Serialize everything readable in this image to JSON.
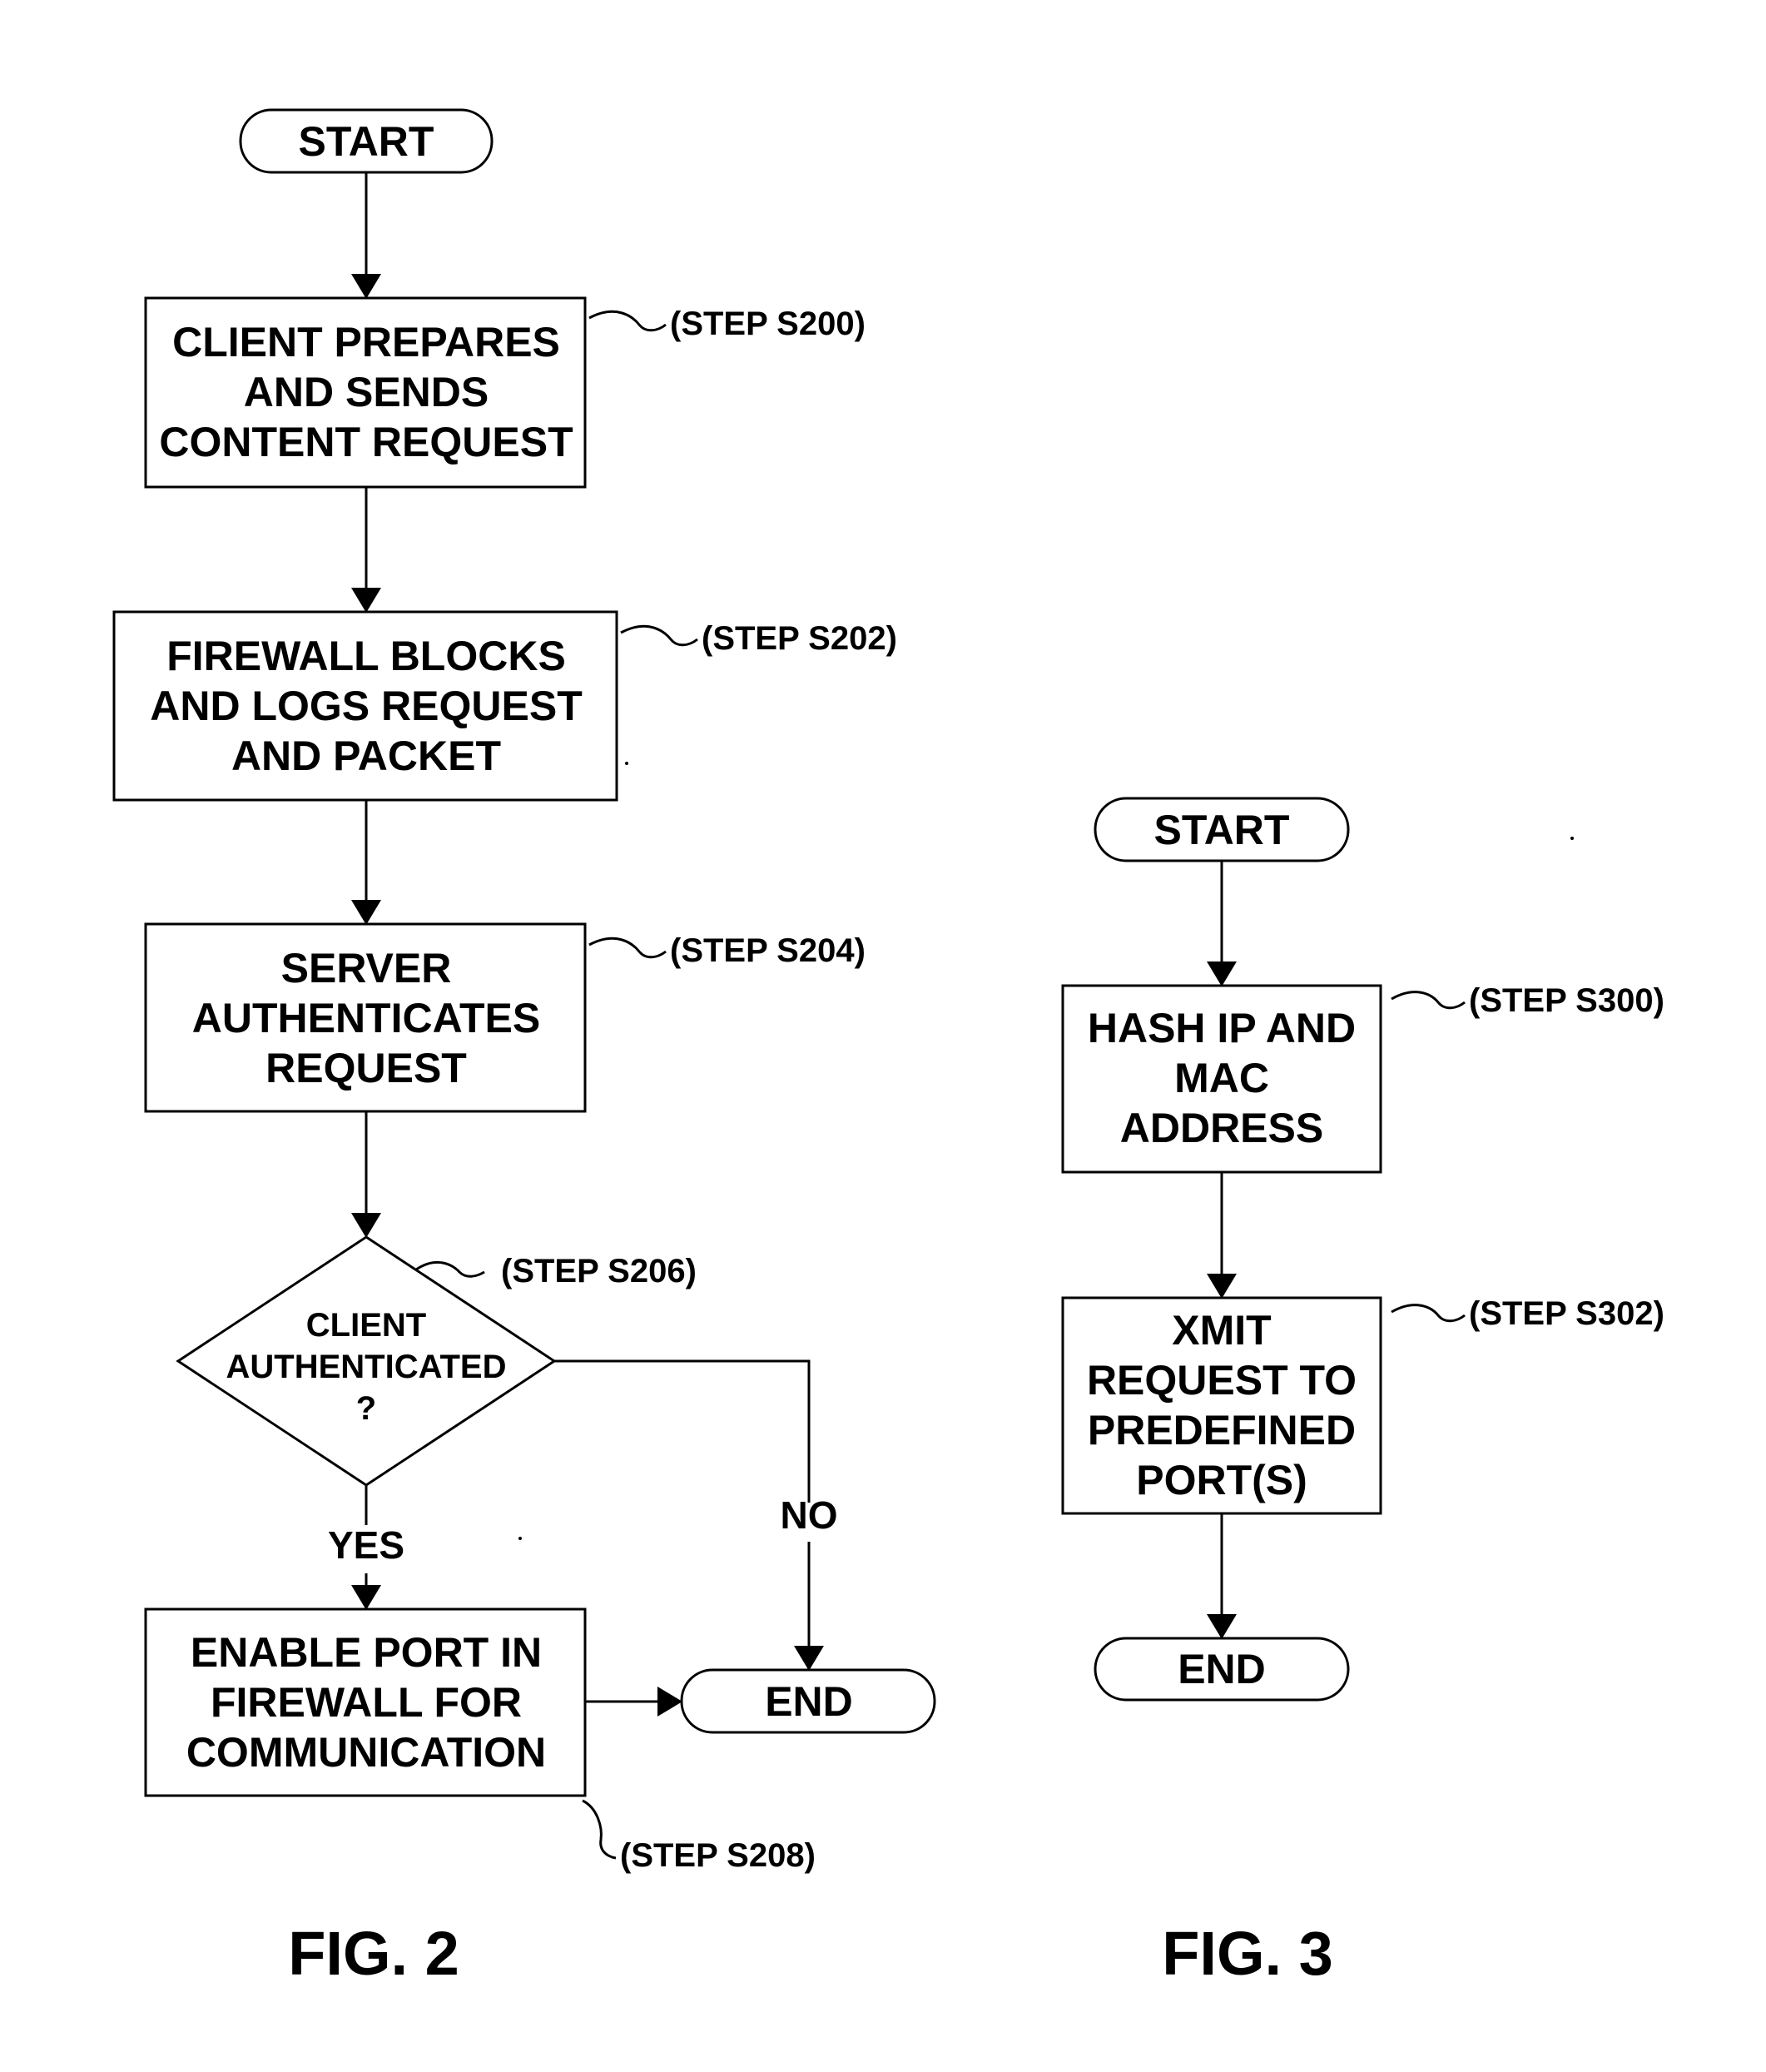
{
  "figures": [
    {
      "id": "fig2",
      "caption": "FIG. 2",
      "nodes": [
        {
          "id": "start",
          "type": "terminal",
          "lines": [
            "START"
          ]
        },
        {
          "id": "s200",
          "type": "process",
          "lines": [
            "CLIENT PREPARES",
            "AND SENDS",
            "CONTENT REQUEST"
          ],
          "step": "(STEP S200)"
        },
        {
          "id": "s202",
          "type": "process",
          "lines": [
            "FIREWALL BLOCKS",
            "AND LOGS REQUEST",
            "AND PACKET"
          ],
          "step": "(STEP S202)"
        },
        {
          "id": "s204",
          "type": "process",
          "lines": [
            "SERVER",
            "AUTHENTICATES",
            "REQUEST"
          ],
          "step": "(STEP S204)"
        },
        {
          "id": "s206",
          "type": "decision",
          "lines": [
            "CLIENT",
            "AUTHENTICATED",
            "?"
          ],
          "step": "(STEP S206)"
        },
        {
          "id": "s208",
          "type": "process",
          "lines": [
            "ENABLE PORT IN",
            "FIREWALL FOR",
            "COMMUNICATION"
          ],
          "step": "(STEP S208)"
        },
        {
          "id": "end",
          "type": "terminal",
          "lines": [
            "END"
          ]
        }
      ],
      "edges": [
        {
          "from": "start",
          "to": "s200",
          "label": ""
        },
        {
          "from": "s200",
          "to": "s202",
          "label": ""
        },
        {
          "from": "s202",
          "to": "s204",
          "label": ""
        },
        {
          "from": "s204",
          "to": "s206",
          "label": ""
        },
        {
          "from": "s206",
          "to": "s208",
          "label": "YES"
        },
        {
          "from": "s206",
          "to": "end",
          "label": "NO"
        },
        {
          "from": "s208",
          "to": "end",
          "label": ""
        }
      ]
    },
    {
      "id": "fig3",
      "caption": "FIG. 3",
      "nodes": [
        {
          "id": "start",
          "type": "terminal",
          "lines": [
            "START"
          ]
        },
        {
          "id": "s300",
          "type": "process",
          "lines": [
            "HASH IP AND",
            "MAC",
            "ADDRESS"
          ],
          "step": "(STEP S300)"
        },
        {
          "id": "s302",
          "type": "process",
          "lines": [
            "XMIT",
            "REQUEST TO",
            "PREDEFINED",
            "PORT(S)"
          ],
          "step": "(STEP S302)"
        },
        {
          "id": "end",
          "type": "terminal",
          "lines": [
            "END"
          ]
        }
      ],
      "edges": [
        {
          "from": "start",
          "to": "s300",
          "label": ""
        },
        {
          "from": "s300",
          "to": "s302",
          "label": ""
        },
        {
          "from": "s302",
          "to": "end",
          "label": ""
        }
      ]
    }
  ]
}
